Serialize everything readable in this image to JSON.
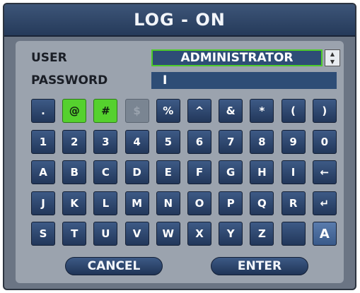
{
  "dialog": {
    "title": "LOG - ON"
  },
  "user": {
    "label": "USER",
    "value": "ADMINISTRATOR"
  },
  "password": {
    "label": "PASSWORD",
    "value": "I"
  },
  "keyboard": {
    "rows": [
      [
        ".",
        "@",
        "#",
        "$",
        "%",
        "^",
        "&",
        "*",
        "(",
        ")"
      ],
      [
        "1",
        "2",
        "3",
        "4",
        "5",
        "6",
        "7",
        "8",
        "9",
        "0"
      ],
      [
        "A",
        "B",
        "C",
        "D",
        "E",
        "F",
        "G",
        "H",
        "I",
        "←"
      ],
      [
        "J",
        "K",
        "L",
        "M",
        "N",
        "O",
        "P",
        "Q",
        "R",
        "↵"
      ],
      [
        "S",
        "T",
        "U",
        "V",
        "W",
        "X",
        "Y",
        "Z",
        "",
        "A"
      ]
    ],
    "selected_keys": [
      "@",
      "#"
    ],
    "disabled_keys": [
      "$"
    ]
  },
  "buttons": {
    "cancel": "CANCEL",
    "enter": "ENTER"
  },
  "colors": {
    "title_bg": "#2f4668",
    "panel_bg": "#9ba3ae",
    "key_bg": "#2e4a72",
    "selected": "#55d12e",
    "field_border_active": "#4ecc2a"
  }
}
